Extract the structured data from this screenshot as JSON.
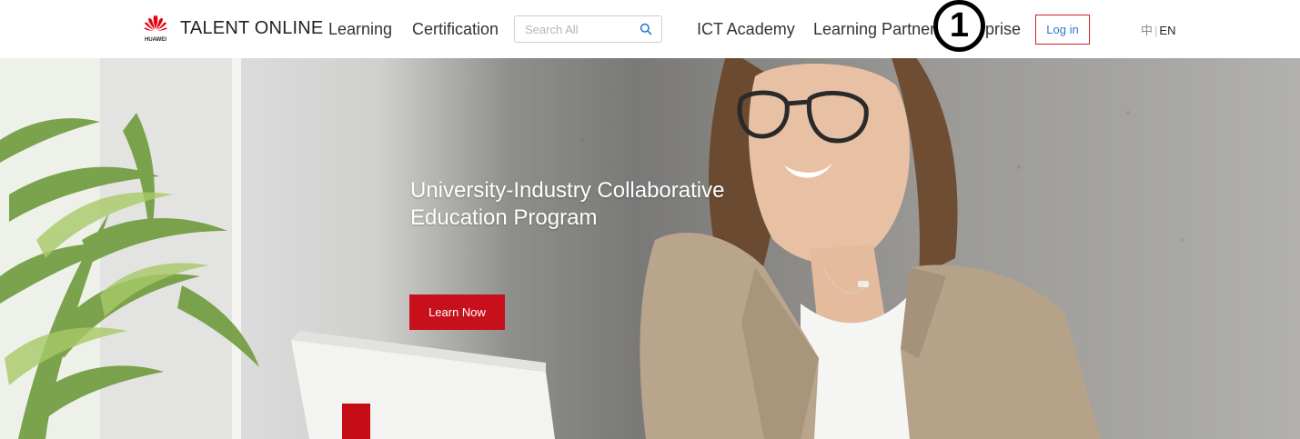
{
  "header": {
    "brand": "TALENT ONLINE",
    "logo_text": "HUAWEI",
    "nav": [
      {
        "label": "Learning",
        "icon": null
      },
      {
        "label": "Certification",
        "icon": null
      },
      {
        "label": "ICT Academy",
        "icon": null
      },
      {
        "label": "Learning Partner",
        "icon": null
      },
      {
        "label": "prise",
        "icon": null
      }
    ],
    "search": {
      "placeholder": "Search All",
      "icon": "search-icon"
    },
    "login_label": "Log in",
    "lang": {
      "zh": "中",
      "sep": "|",
      "en": "EN"
    },
    "step_marker": "1"
  },
  "hero": {
    "title_line1": "University-Industry Collaborative",
    "title_line2": "Education Program",
    "button_label": "Learn Now"
  },
  "colors": {
    "brand_red": "#c7101c",
    "link_blue": "#2b7ad1",
    "login_border": "#d21f2b"
  }
}
